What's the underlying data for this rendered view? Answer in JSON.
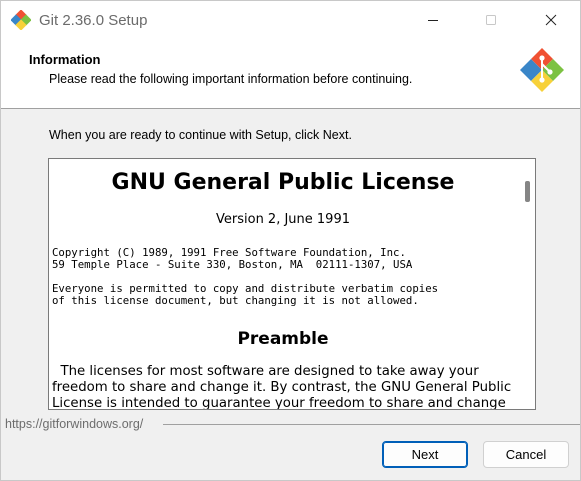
{
  "window": {
    "title": "Git 2.36.0 Setup",
    "icon": "git-logo-icon",
    "controls": [
      "minimize-icon",
      "maximize-icon",
      "close-icon"
    ]
  },
  "header": {
    "title": "Information",
    "subtitle": "Please read the following important information before continuing.",
    "logo": "git-logo-icon"
  },
  "main": {
    "intro": "When you are ready to continue with Setup, click Next.",
    "license": {
      "title": "GNU General Public License",
      "version": "Version 2, June 1991",
      "copyright_lines": [
        "Copyright (C) 1989, 1991 Free Software Foundation, Inc.",
        "59 Temple Place - Suite 330, Boston, MA  02111-1307, USA"
      ],
      "permission_lines": [
        "Everyone is permitted to copy and distribute verbatim copies",
        "of this license document, but changing it is not allowed."
      ],
      "preamble_heading": "Preamble",
      "preamble_lines": [
        "  The licenses for most software are designed to take away your",
        "freedom to share and change it. By contrast, the GNU General Public",
        "License is intended to guarantee your freedom to share and change"
      ]
    }
  },
  "footer": {
    "link": "https://gitforwindows.org/",
    "next_label": "Next",
    "cancel_label": "Cancel"
  },
  "colors": {
    "accent": "#005fb8",
    "git_orange": "#f05133",
    "git_green": "#7cc242",
    "git_blue": "#3a86c8",
    "git_yellow": "#f7d13a"
  }
}
